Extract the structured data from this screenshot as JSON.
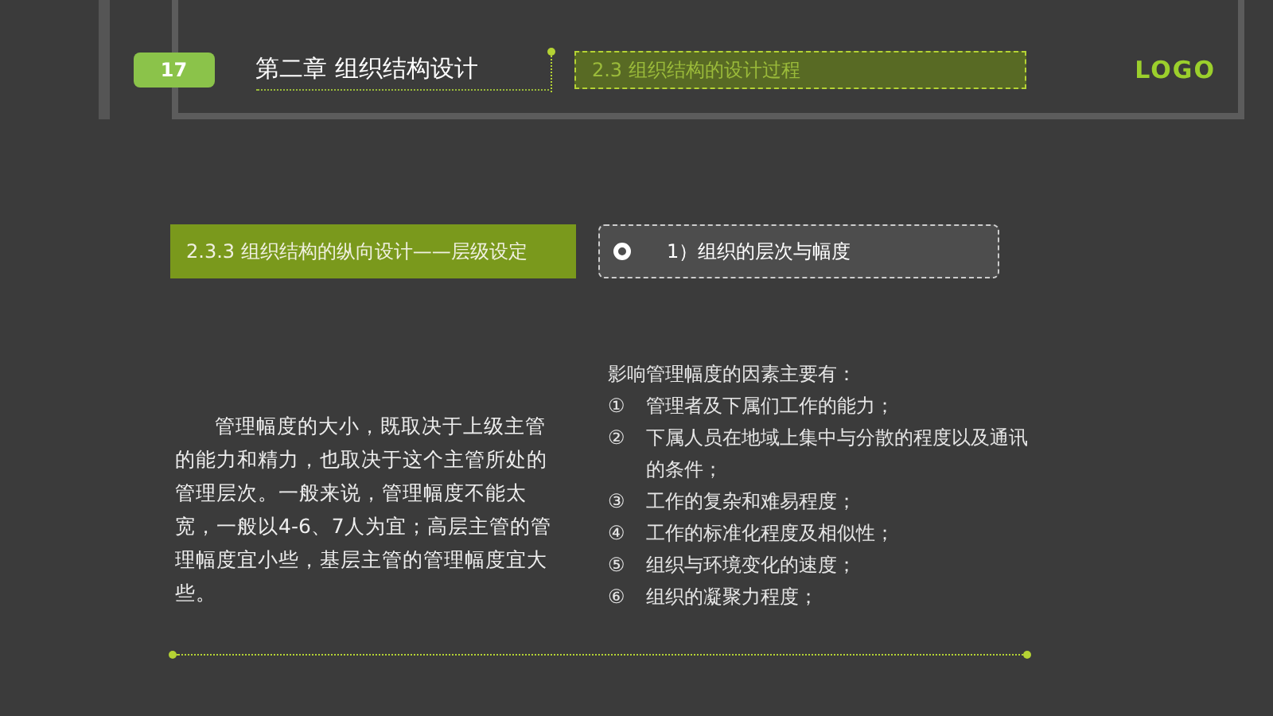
{
  "header": {
    "page_number": "17",
    "chapter_title": "第二章  组织结构设计",
    "section_title": "2.3 组织结构的设计过程",
    "logo": "LOGO"
  },
  "subsection": {
    "title": "2.3.3 组织结构的纵向设计——层级设定",
    "topic": "1）组织的层次与幅度"
  },
  "paragraph": "管理幅度的大小，既取决于上级主管的能力和精力，也取决于这个主管所处的管理层次。一般来说，管理幅度不能太宽，一般以4-6、7人为宜；高层主管的管理幅度宜小些，基层主管的管理幅度宜大些。",
  "factors": {
    "heading": "影响管理幅度的因素主要有：",
    "items": [
      {
        "number": "①",
        "text": "管理者及下属们工作的能力；"
      },
      {
        "number": "②",
        "text": "下属人员在地域上集中与分散的程度以及通讯的条件；"
      },
      {
        "number": "③",
        "text": "工作的复杂和难易程度；"
      },
      {
        "number": "④",
        "text": "工作的标准化程度及相似性；"
      },
      {
        "number": "⑤",
        "text": "组织与环境变化的速度；"
      },
      {
        "number": "⑥",
        "text": "组织的凝聚力程度；"
      }
    ]
  }
}
